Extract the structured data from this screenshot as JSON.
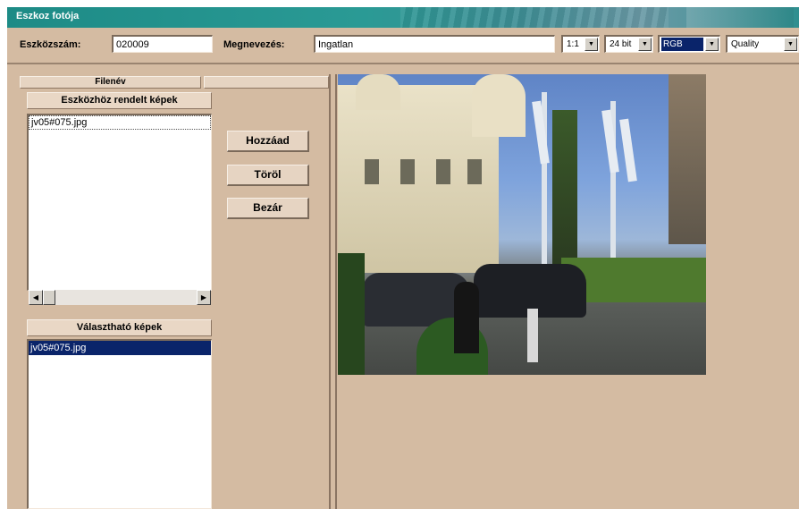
{
  "window": {
    "title": "Eszkoz fotója"
  },
  "toolbar": {
    "asset_number_label": "Eszközszám:",
    "asset_number_value": "020009",
    "name_label": "Megnevezés:",
    "name_value": "Ingatlan",
    "zoom_value": "1:1",
    "depth_value": "24 bit",
    "color_value": "RGB",
    "quality_value": "Quality"
  },
  "left_panel": {
    "tab_label": "Filenév",
    "assigned_header": "Eszközhöz rendelt képek",
    "assigned_items": [
      "jv05#075.jpg"
    ],
    "available_header": "Választható képek",
    "available_items": [
      "jv05#075.jpg"
    ]
  },
  "buttons": {
    "add": "Hozzáad",
    "delete": "Töröl",
    "close": "Bezár"
  },
  "colors": {
    "panel_bg": "#d4bba2",
    "title_bar": "#1d8b86",
    "selection": "#0a246a"
  }
}
